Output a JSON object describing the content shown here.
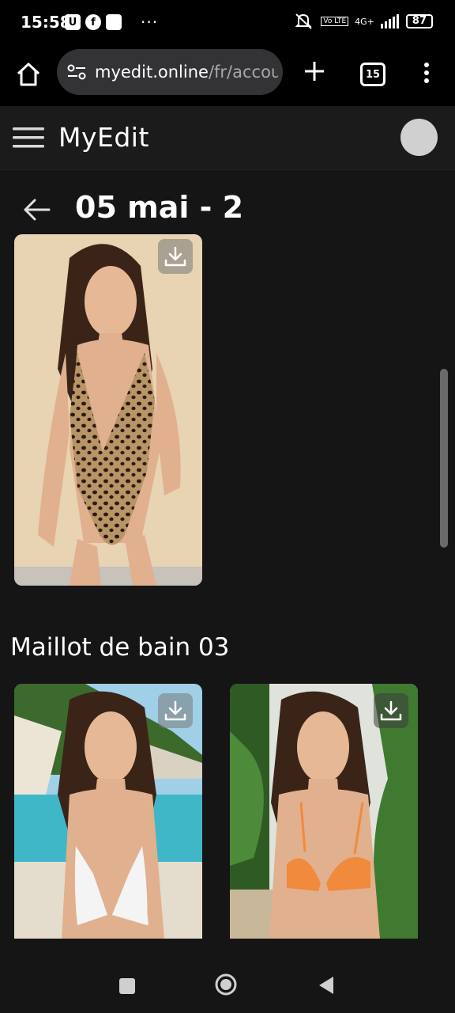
{
  "status_bar": {
    "time": "15:58",
    "app_icons": [
      "U",
      "f",
      ""
    ],
    "more": "···",
    "network": "4G+",
    "volte": "Vo LTE",
    "battery": "87"
  },
  "browser": {
    "url_host": "myedit.online",
    "url_path": "/fr/accou",
    "tab_count": "15"
  },
  "app": {
    "logo": "MyEdit"
  },
  "page": {
    "title": "05 mai - 2",
    "section_title": "Maillot de bain 03"
  },
  "photos": [
    {
      "name": "photo-leopard-swimsuit",
      "swimsuit_color": "#8a6a45",
      "bg_color": "#e8d3b2"
    },
    {
      "name": "photo-white-swimsuit",
      "swimsuit_color": "#f4f4f4",
      "bg_color": "#3fb7c6"
    },
    {
      "name": "photo-orange-bikini",
      "swimsuit_color": "#f08a3c",
      "bg_color": "#dfe3dc"
    }
  ],
  "icons": [
    "home-icon",
    "tune-icon",
    "plus-icon",
    "tabs-icon",
    "more-vert-icon",
    "menu-icon",
    "back-arrow-icon",
    "download-icon"
  ],
  "colors": {
    "background": "#151515",
    "header": "#1b1b1b",
    "url_pill": "#333336",
    "avatar": "#d0d0d0"
  }
}
